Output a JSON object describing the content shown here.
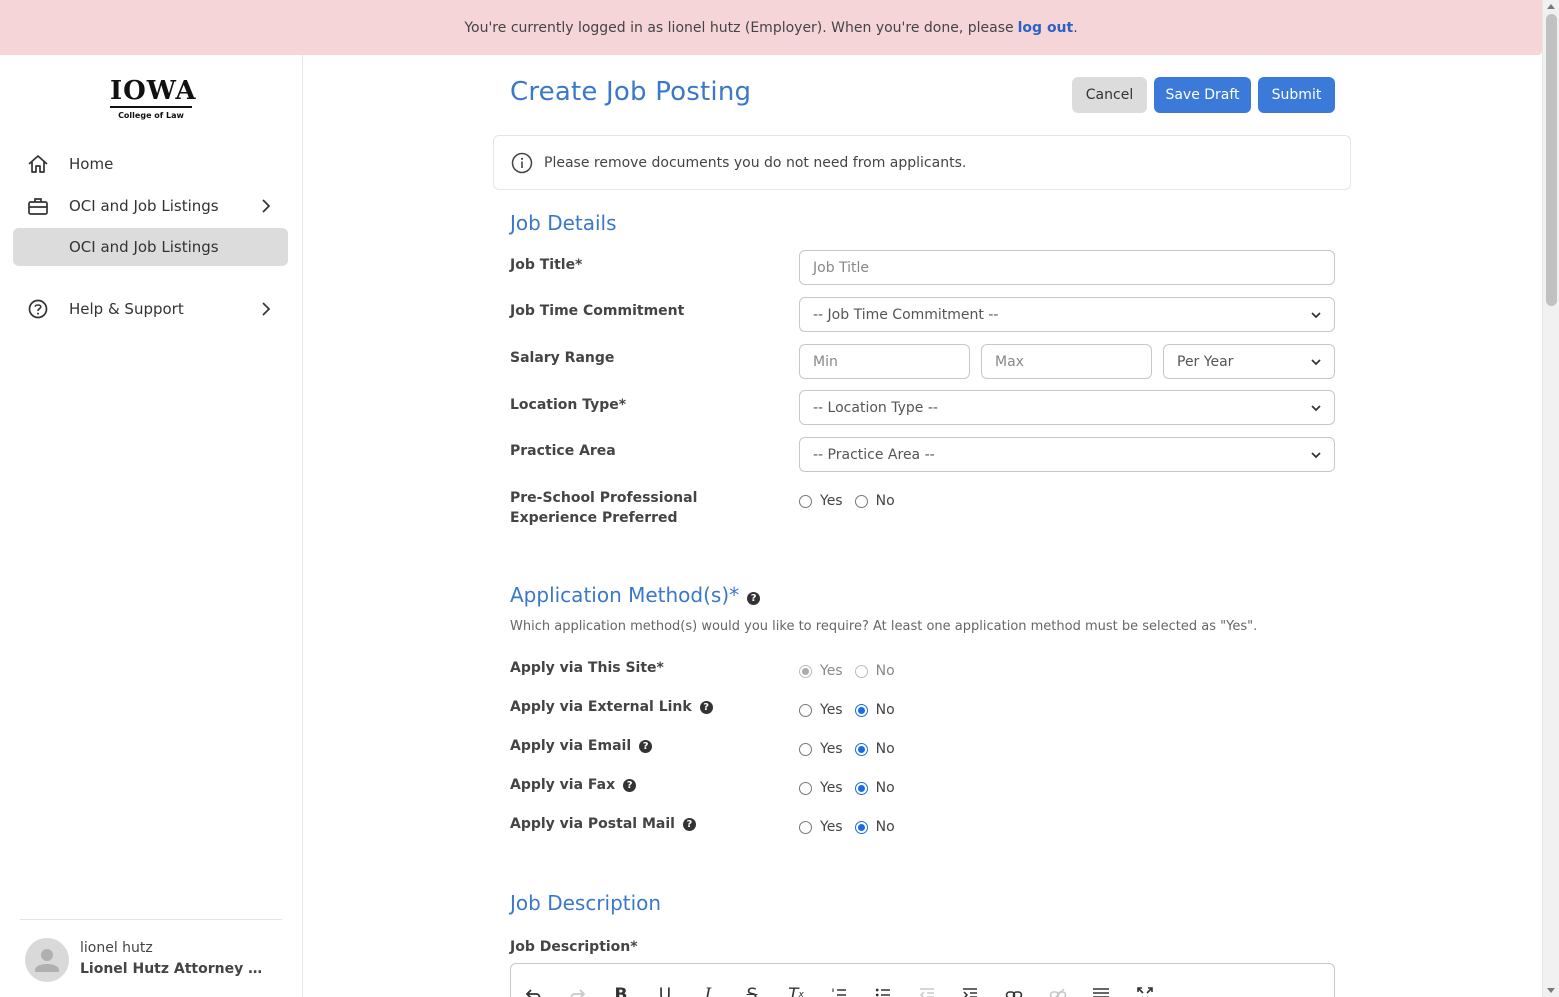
{
  "banner": {
    "text": "You're currently logged in as lionel hutz (Employer). When you're done, please",
    "link": "log out",
    "after": "."
  },
  "sidebar": {
    "logo": {
      "title": "IOWA",
      "subtitle": "College of Law"
    },
    "items": [
      {
        "label": "Home",
        "icon": "home-icon"
      },
      {
        "label": "OCI and Job Listings",
        "icon": "briefcase-icon"
      },
      {
        "label": "OCI and Job Listings"
      },
      {
        "label": "Help & Support",
        "icon": "help-circle-icon"
      }
    ],
    "user": {
      "name": "lionel hutz",
      "org": "Lionel Hutz Attorney at L..."
    }
  },
  "page": {
    "title": "Create Job Posting",
    "buttons": {
      "cancel": "Cancel",
      "save_draft": "Save Draft",
      "submit": "Submit"
    },
    "info": "Please remove documents you do not need from applicants."
  },
  "job_details": {
    "heading": "Job Details",
    "job_title": {
      "label": "Job Title*",
      "placeholder": "Job Title"
    },
    "time_commitment": {
      "label": "Job Time Commitment",
      "value": "-- Job Time Commitment --"
    },
    "salary": {
      "label": "Salary Range",
      "min_placeholder": "Min",
      "max_placeholder": "Max",
      "period": "Per Year"
    },
    "location_type": {
      "label": "Location Type*",
      "value": "-- Location Type --"
    },
    "practice_area": {
      "label": "Practice Area",
      "value": "-- Practice Area --"
    },
    "pre_school": {
      "label": "Pre-School Professional Experience Preferred",
      "yes": "Yes",
      "no": "No"
    }
  },
  "application": {
    "heading": "Application Method(s)*",
    "hint": "Which application method(s) would you like to require? At least one application method must be selected as \"Yes\".",
    "yes": "Yes",
    "no": "No",
    "methods": [
      {
        "label": "Apply via This Site*",
        "selected": "yes"
      },
      {
        "label": "Apply via External Link",
        "selected": "no"
      },
      {
        "label": "Apply via Email",
        "selected": "no"
      },
      {
        "label": "Apply via Fax",
        "selected": "no"
      },
      {
        "label": "Apply via Postal Mail",
        "selected": "no"
      }
    ]
  },
  "description": {
    "heading": "Job Description",
    "label": "Job Description*",
    "toolbar": [
      "undo-icon",
      "redo-icon",
      "bold-icon",
      "underline-icon",
      "italic-icon",
      "strikethrough-icon",
      "clear-format-icon",
      "ordered-list-icon",
      "bullet-list-icon",
      "outdent-icon",
      "indent-icon",
      "link-icon",
      "unlink-icon",
      "horizontal-rule-icon",
      "fullscreen-icon"
    ]
  },
  "colors": {
    "accent": "#3b78c9",
    "button": "#3b7ad9",
    "banner": "#f5d5d8"
  }
}
